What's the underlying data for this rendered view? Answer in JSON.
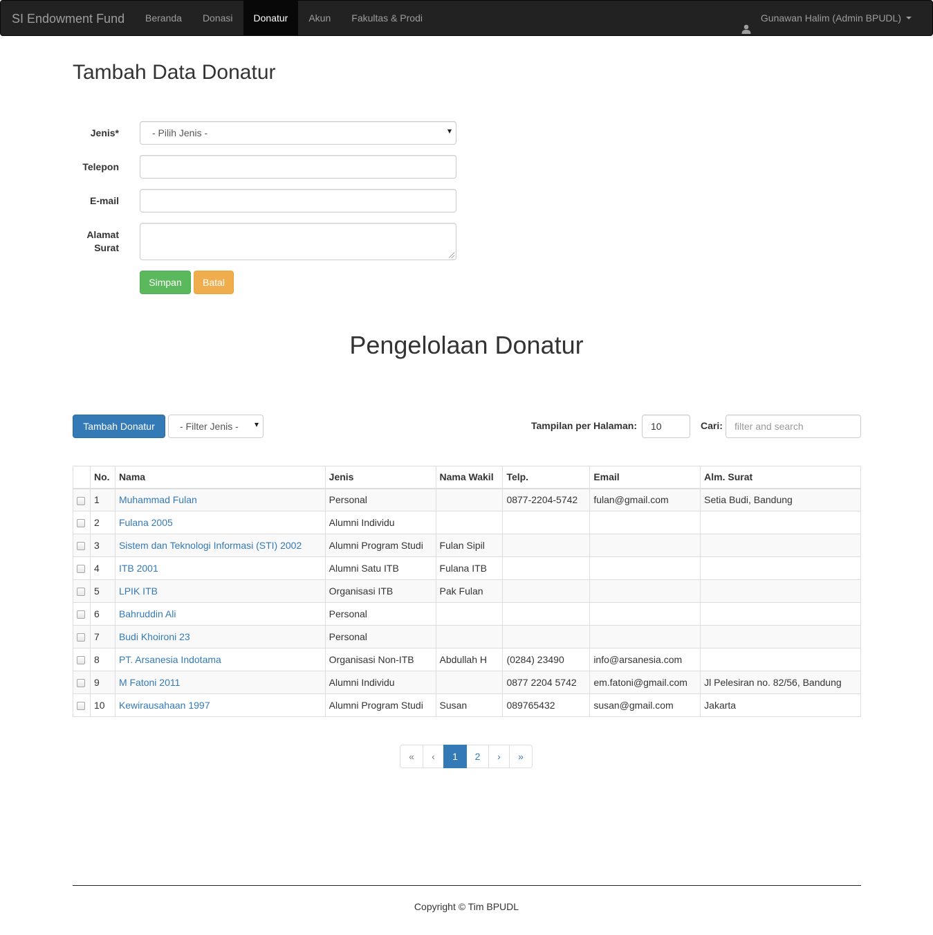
{
  "navbar": {
    "brand": "SI Endowment Fund",
    "items": [
      {
        "label": "Beranda",
        "active": false
      },
      {
        "label": "Donasi",
        "active": false
      },
      {
        "label": "Donatur",
        "active": true
      },
      {
        "label": "Akun",
        "active": false
      },
      {
        "label": "Fakultas & Prodi",
        "active": false
      }
    ],
    "user": "Gunawan Halim (Admin BPUDL)"
  },
  "form": {
    "title": "Tambah Data Donatur",
    "jenis_label": "Jenis*",
    "jenis_value": "- Pilih Jenis -",
    "telepon_label": "Telepon",
    "email_label": "E-mail",
    "alamat_label_1": "Alamat",
    "alamat_label_2": "Surat",
    "save_label": "Simpan",
    "cancel_label": "Batal"
  },
  "manage": {
    "title": "Pengelolaan Donatur",
    "add_button": "Tambah Donatur",
    "filter_value": "- Filter Jenis -",
    "per_page_label": "Tampilan per Halaman:",
    "per_page_value": "10",
    "search_label": "Cari:",
    "search_placeholder": "filter and search"
  },
  "table": {
    "headers": [
      "No.",
      "Nama",
      "Jenis",
      "Nama Wakil",
      "Telp.",
      "Email",
      "Alm. Surat"
    ],
    "rows": [
      {
        "no": "1",
        "nama": "Muhammad Fulan",
        "jenis": "Personal",
        "wakil": "",
        "telp": "0877-2204-5742",
        "email": "fulan@gmail.com",
        "alamat": "Setia Budi, Bandung"
      },
      {
        "no": "2",
        "nama": "Fulana 2005",
        "jenis": "Alumni Individu",
        "wakil": "",
        "telp": "",
        "email": "",
        "alamat": ""
      },
      {
        "no": "3",
        "nama": "Sistem dan Teknologi Informasi (STI) 2002",
        "jenis": "Alumni Program Studi",
        "wakil": "Fulan Sipil",
        "telp": "",
        "email": "",
        "alamat": ""
      },
      {
        "no": "4",
        "nama": "ITB 2001",
        "jenis": "Alumni Satu ITB",
        "wakil": "Fulana ITB",
        "telp": "",
        "email": "",
        "alamat": ""
      },
      {
        "no": "5",
        "nama": "LPIK ITB",
        "jenis": "Organisasi ITB",
        "wakil": "Pak Fulan",
        "telp": "",
        "email": "",
        "alamat": ""
      },
      {
        "no": "6",
        "nama": "Bahruddin Ali",
        "jenis": "Personal",
        "wakil": "",
        "telp": "",
        "email": "",
        "alamat": ""
      },
      {
        "no": "7",
        "nama": "Budi Khoironi 23",
        "jenis": "Personal",
        "wakil": "",
        "telp": "",
        "email": "",
        "alamat": ""
      },
      {
        "no": "8",
        "nama": "PT. Arsanesia Indotama",
        "jenis": "Organisasi Non-ITB",
        "wakil": "Abdullah H",
        "telp": "(0284) 23490",
        "email": "info@arsanesia.com",
        "alamat": ""
      },
      {
        "no": "9",
        "nama": "M Fatoni 2011",
        "jenis": "Alumni Individu",
        "wakil": "",
        "telp": "0877 2204 5742",
        "email": "em.fatoni@gmail.com",
        "alamat": "Jl Pelesiran no. 82/56, Bandung"
      },
      {
        "no": "10",
        "nama": "Kewirausahaan 1997",
        "jenis": "Alumni Program Studi",
        "wakil": "Susan",
        "telp": "089765432",
        "email": "susan@gmail.com",
        "alamat": "Jakarta"
      }
    ]
  },
  "pagination": {
    "first": "«",
    "prev": "‹",
    "pages": [
      "1",
      "2"
    ],
    "active": "1",
    "next": "›",
    "last": "»"
  },
  "footer": {
    "text": "Copyright © Tim BPUDL"
  },
  "colors": {
    "navbar_bg": "#222222",
    "primary": "#337ab7",
    "success": "#5cb85c",
    "warning": "#f0ad4e"
  }
}
